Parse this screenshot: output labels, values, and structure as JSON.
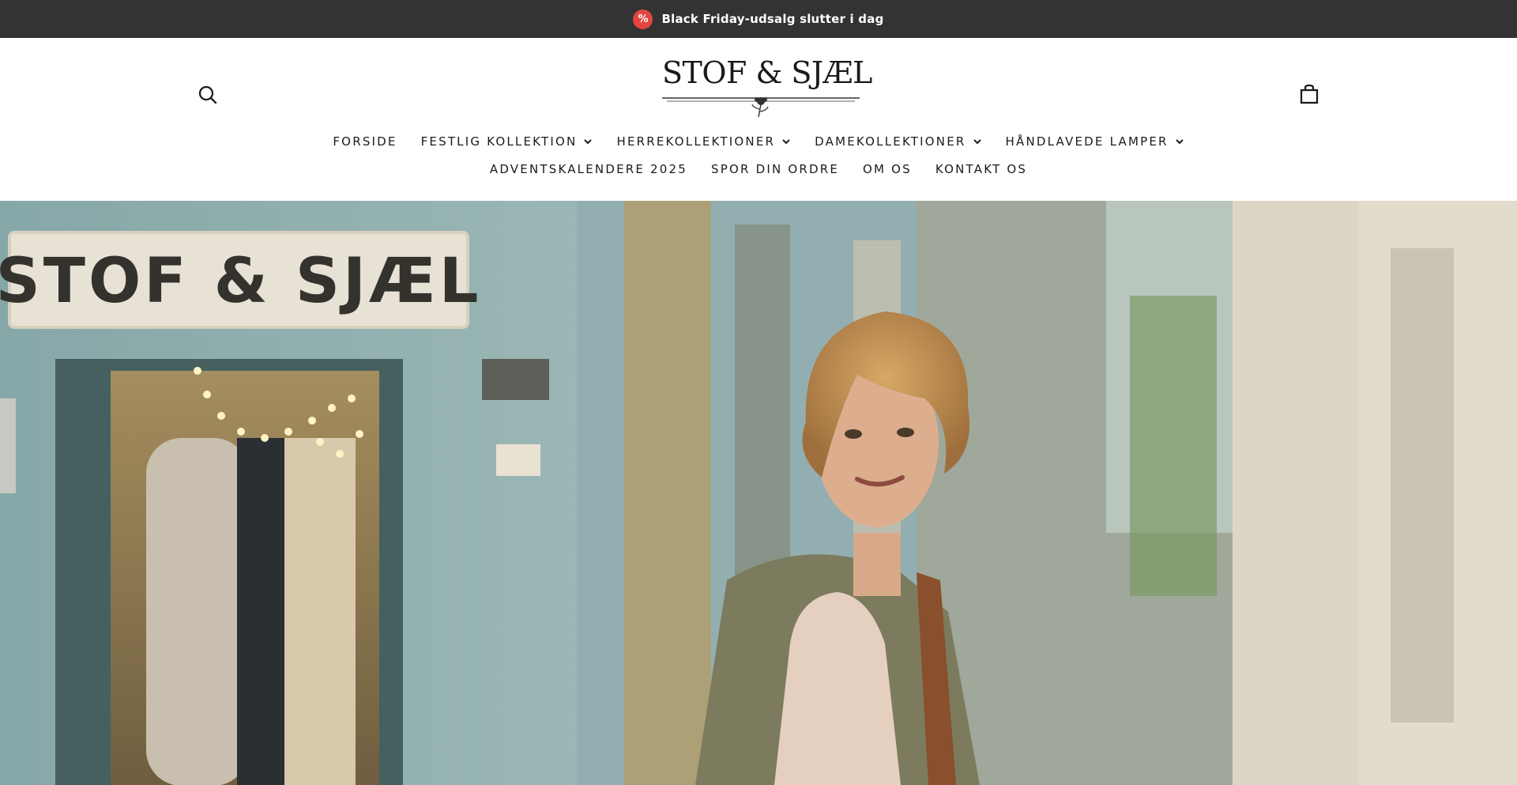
{
  "announcement": {
    "badge_symbol": "%",
    "badge_color": "#e2463f",
    "text": "Black Friday-udsalg slutter i dag"
  },
  "header": {
    "logo_text": "STOF & SJÆL",
    "search_icon": "search-icon",
    "cart_icon": "shopping-bag-icon"
  },
  "nav": {
    "row1": [
      {
        "label": "FORSIDE",
        "dropdown": false
      },
      {
        "label": "FESTLIG KOLLEKTION",
        "dropdown": true
      },
      {
        "label": "HERREKOLLEKTIONER",
        "dropdown": true
      },
      {
        "label": "DAMEKOLLEKTIONER",
        "dropdown": true
      },
      {
        "label": "HÅNDLAVEDE LAMPER",
        "dropdown": true
      }
    ],
    "row2": [
      {
        "label": "ADVENTSKALENDERE 2025",
        "dropdown": false
      },
      {
        "label": "SPOR DIN ORDRE",
        "dropdown": false
      },
      {
        "label": "OM OS",
        "dropdown": false
      },
      {
        "label": "KONTAKT OS",
        "dropdown": false
      }
    ]
  },
  "hero": {
    "storefront_sign": "STOF & SJÆL",
    "alt": "Kvinde foran Stof & Sjæl butik"
  },
  "colors": {
    "announcement_bg": "#333333",
    "text": "#1c1c1c"
  }
}
